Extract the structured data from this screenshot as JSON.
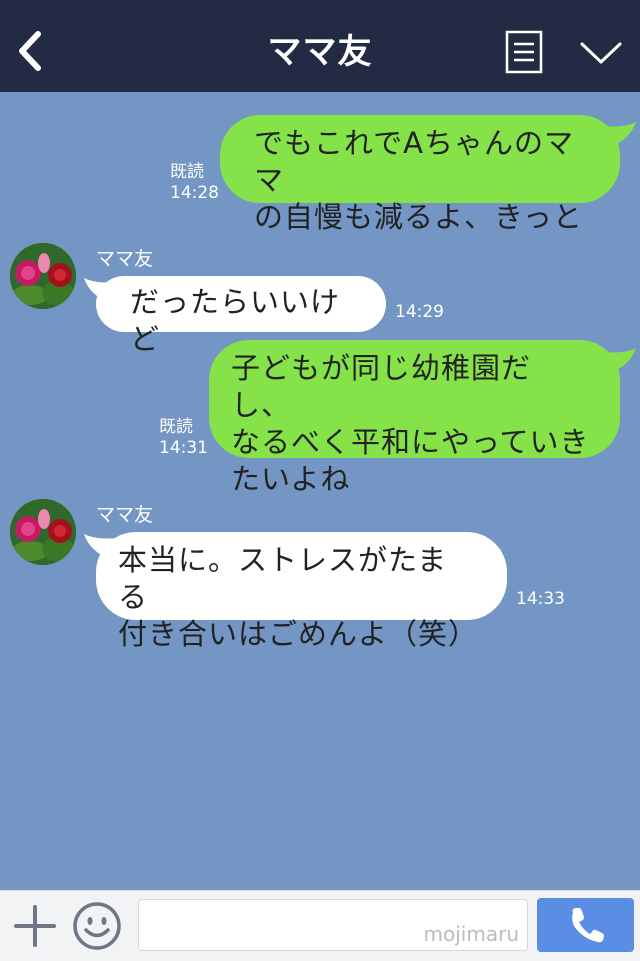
{
  "header": {
    "title": "ママ友",
    "back_icon": "chevron-left-icon",
    "menu_icon": "list-icon",
    "more_icon": "chevron-down-icon",
    "background": "#232b44"
  },
  "colors": {
    "chat_background": "#7396c4",
    "my_bubble": "#85e249",
    "their_bubble": "#ffffff",
    "call_button": "#5a8de4"
  },
  "messages": [
    {
      "side": "me",
      "lines": [
        "でもこれでAちゃんのママ",
        "の自慢も減るよ、きっと"
      ],
      "read": "既読",
      "time": "14:28"
    },
    {
      "side": "them",
      "sender": "ママ友",
      "lines": [
        "だったらいいけど"
      ],
      "time": "14:29"
    },
    {
      "side": "me",
      "lines": [
        "子どもが同じ幼稚園だし、",
        "なるべく平和にやっていき",
        "たいよね"
      ],
      "read": "既読",
      "time": "14:31"
    },
    {
      "side": "them",
      "sender": "ママ友",
      "lines": [
        "本当に。ストレスがたまる",
        "付き合いはごめんよ（笑）"
      ],
      "time": "14:33"
    }
  ],
  "input_bar": {
    "plus_icon": "plus-icon",
    "emoji_icon": "smiley-icon",
    "placeholder": "",
    "watermark": "mojimaru",
    "call_icon": "phone-icon"
  }
}
